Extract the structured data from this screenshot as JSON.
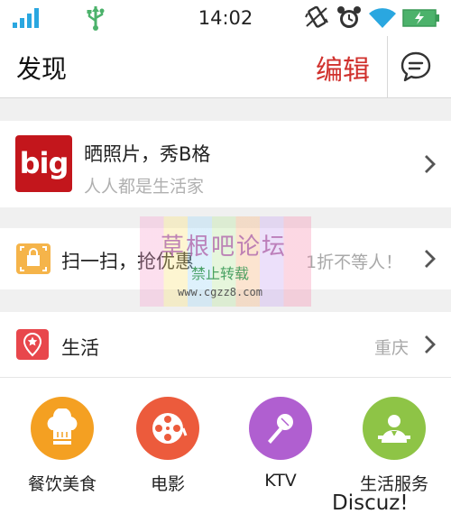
{
  "status_bar": {
    "time": "14:02",
    "icons": [
      "signal-icon",
      "usb-icon",
      "vibrate-icon",
      "alarm-icon",
      "wifi-icon",
      "battery-icon"
    ]
  },
  "header": {
    "title": "发现",
    "edit_label": "编辑",
    "message_icon": "chat-bubble-icon"
  },
  "feature": {
    "logo_text": "big",
    "title": "晒照片，秀B格",
    "subtitle": "人人都是生活家"
  },
  "scan": {
    "icon": "scan-bag-icon",
    "title": "扫一扫，抢优惠",
    "right_text": "1折不等人！"
  },
  "life": {
    "icon": "location-star-icon",
    "title": "生活",
    "city": "重庆"
  },
  "categories": [
    {
      "label": "餐饮美食",
      "icon": "chef-hat-icon",
      "color": "#f4a022"
    },
    {
      "label": "电影",
      "icon": "film-reel-icon",
      "color": "#ec5b3c"
    },
    {
      "label": "KTV",
      "icon": "microphone-icon",
      "color": "#b05fd0"
    },
    {
      "label": "生活服务",
      "icon": "service-person-icon",
      "color": "#8ec446"
    }
  ],
  "watermark": {
    "title": "草根吧论坛",
    "subtitle": "禁止转载",
    "url": "www.cgzz8.com"
  },
  "footer_watermark": "Discuz!",
  "colors": {
    "accent_red": "#d0312d",
    "big_red": "#c3161c",
    "status_green": "#4cb26b",
    "wifi_blue": "#2aa7e0",
    "scan_orange": "#f5b44a",
    "life_red": "#e8474c"
  }
}
